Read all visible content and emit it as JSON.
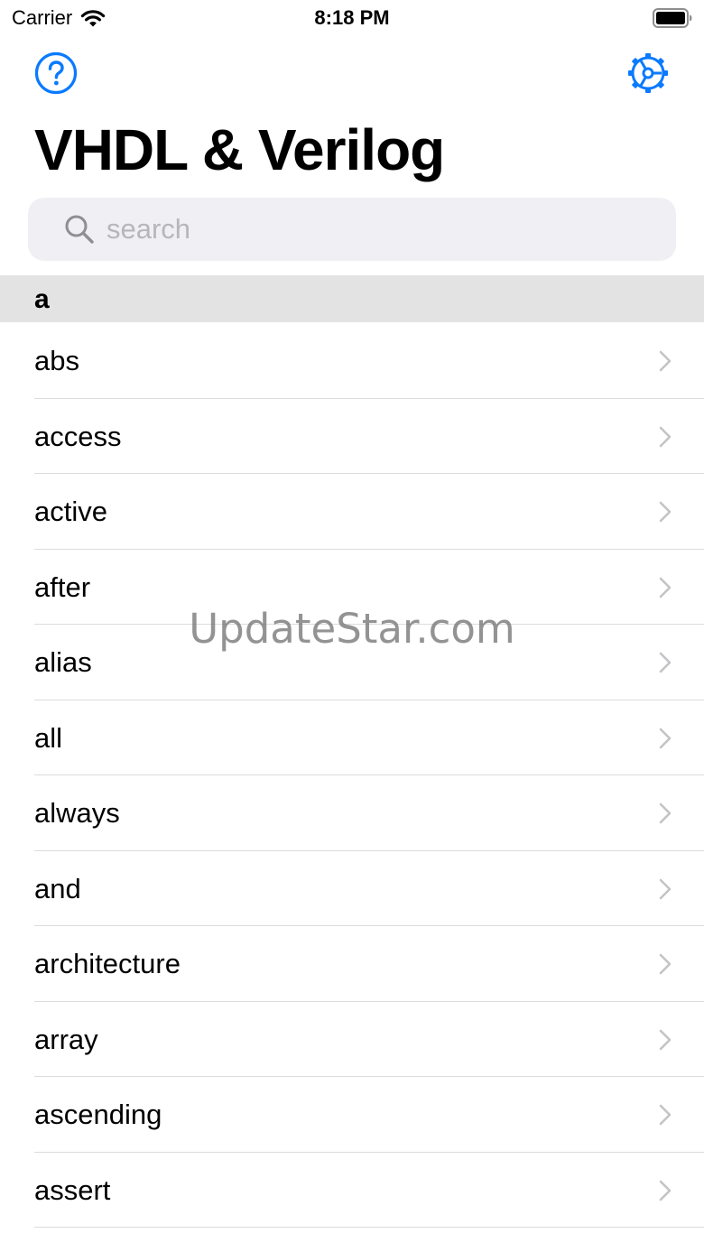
{
  "status_bar": {
    "carrier": "Carrier",
    "time": "8:18 PM",
    "wifi_icon": "wifi-icon",
    "battery_icon": "battery-full-icon"
  },
  "nav": {
    "help_icon": "question-circle-icon",
    "settings_icon": "gear-icon"
  },
  "title": "VHDL & Verilog",
  "search": {
    "placeholder": "search",
    "value": "",
    "icon": "magnifying-glass-icon"
  },
  "section": {
    "header": "a",
    "items": [
      {
        "label": "abs"
      },
      {
        "label": "access"
      },
      {
        "label": "active"
      },
      {
        "label": "after"
      },
      {
        "label": "alias"
      },
      {
        "label": "all"
      },
      {
        "label": "always"
      },
      {
        "label": "and"
      },
      {
        "label": "architecture"
      },
      {
        "label": "array"
      },
      {
        "label": "ascending"
      },
      {
        "label": "assert"
      }
    ]
  },
  "watermark": "UpdateStar.com",
  "colors": {
    "accent": "#0a7aff",
    "search_background": "#efeff4",
    "section_header_background": "#e3e3e3",
    "separator": "#dcdcde",
    "chevron": "#c4c4c7",
    "placeholder": "#b6b6bb"
  }
}
